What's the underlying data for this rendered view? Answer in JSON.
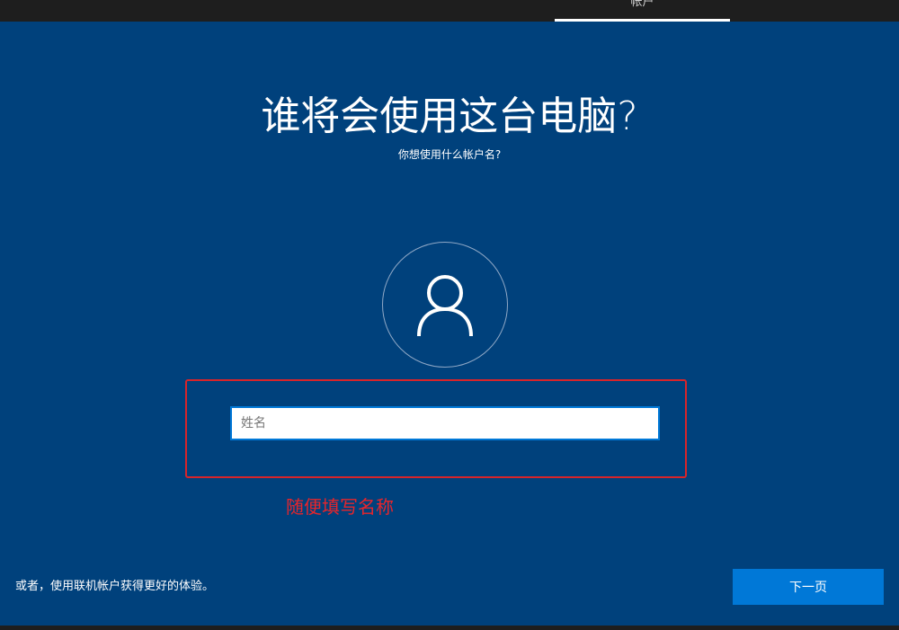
{
  "header": {
    "active_tab_label": "帐户"
  },
  "main": {
    "title": "谁将会使用这台电脑?",
    "subtitle": "你想使用什么帐户名?",
    "avatar_icon": "user-icon",
    "name_input": {
      "value": "",
      "placeholder": "姓名"
    },
    "annotation_text": "随便填写名称"
  },
  "footer": {
    "online_account_link": "或者，使用联机帐户获得更好的体验。",
    "next_button_label": "下一页"
  },
  "colors": {
    "background": "#00417c",
    "accent": "#0078d7",
    "annotation": "#e8252b"
  }
}
